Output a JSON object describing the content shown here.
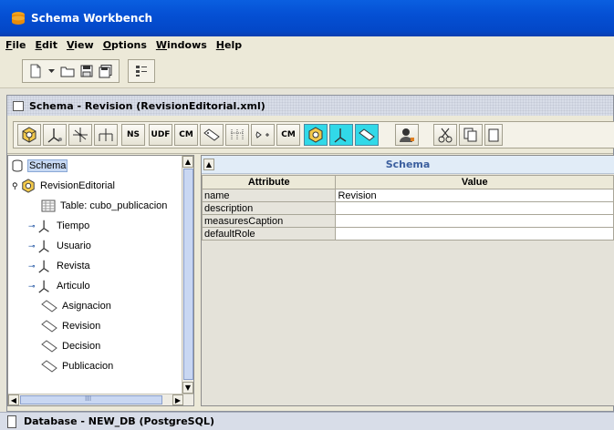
{
  "app": {
    "title": "Schema Workbench"
  },
  "menu": [
    "File",
    "Edit",
    "View",
    "Options",
    "Windows",
    "Help"
  ],
  "inner_window": {
    "title": "Schema - Revision (RevisionEditorial.xml)"
  },
  "schema_toolbar": {
    "buttons": [
      {
        "name": "cube-icon",
        "label": ""
      },
      {
        "name": "dimension-icon",
        "label": ""
      },
      {
        "name": "dimension-usage-icon",
        "label": ""
      },
      {
        "name": "virtual-cube-icon",
        "label": ""
      },
      {
        "name": "named-set-button",
        "label": "NS"
      },
      {
        "name": "user-defined-function-button",
        "label": "UDF"
      },
      {
        "name": "calculated-member-button",
        "label": "CM"
      },
      {
        "name": "measure-icon",
        "label": ""
      },
      {
        "name": "level-icon",
        "label": ""
      },
      {
        "name": "property-icon",
        "label": ""
      },
      {
        "name": "calculated-member-level-button",
        "label": "CM"
      },
      {
        "name": "cube-add-icon",
        "label": ""
      },
      {
        "name": "dimension-add-icon",
        "label": ""
      },
      {
        "name": "measure-add-icon",
        "label": ""
      },
      {
        "name": "role-icon",
        "label": ""
      },
      {
        "name": "cut-icon",
        "label": ""
      },
      {
        "name": "copy-icon",
        "label": ""
      }
    ]
  },
  "tree": {
    "root": "Schema",
    "items": [
      {
        "label": "RevisionEditorial",
        "icon": "cube-icon"
      },
      {
        "label": "Table: cubo_publicacion",
        "icon": "table-icon"
      },
      {
        "label": "Tiempo",
        "icon": "dimension-icon"
      },
      {
        "label": "Usuario",
        "icon": "dimension-icon"
      },
      {
        "label": "Revista",
        "icon": "dimension-icon"
      },
      {
        "label": "Articulo",
        "icon": "dimension-icon"
      },
      {
        "label": "Asignacion",
        "icon": "measure-icon"
      },
      {
        "label": "Revision",
        "icon": "measure-icon"
      },
      {
        "label": "Decision",
        "icon": "measure-icon"
      },
      {
        "label": "Publicacion",
        "icon": "measure-icon"
      }
    ],
    "hscroll_mark": "III"
  },
  "properties": {
    "header": "Schema",
    "col_attribute": "Attribute",
    "col_value": "Value",
    "rows": [
      {
        "attribute": "name",
        "value": "Revision"
      },
      {
        "attribute": "description",
        "value": ""
      },
      {
        "attribute": "measuresCaption",
        "value": ""
      },
      {
        "attribute": "defaultRole",
        "value": ""
      }
    ]
  },
  "database_window": {
    "title": "Database - NEW_DB (PostgreSQL)"
  },
  "colors": {
    "titlebar": "#0550d4",
    "accent_cyan": "#31d9e8",
    "header_text": "#3b5f9e"
  }
}
